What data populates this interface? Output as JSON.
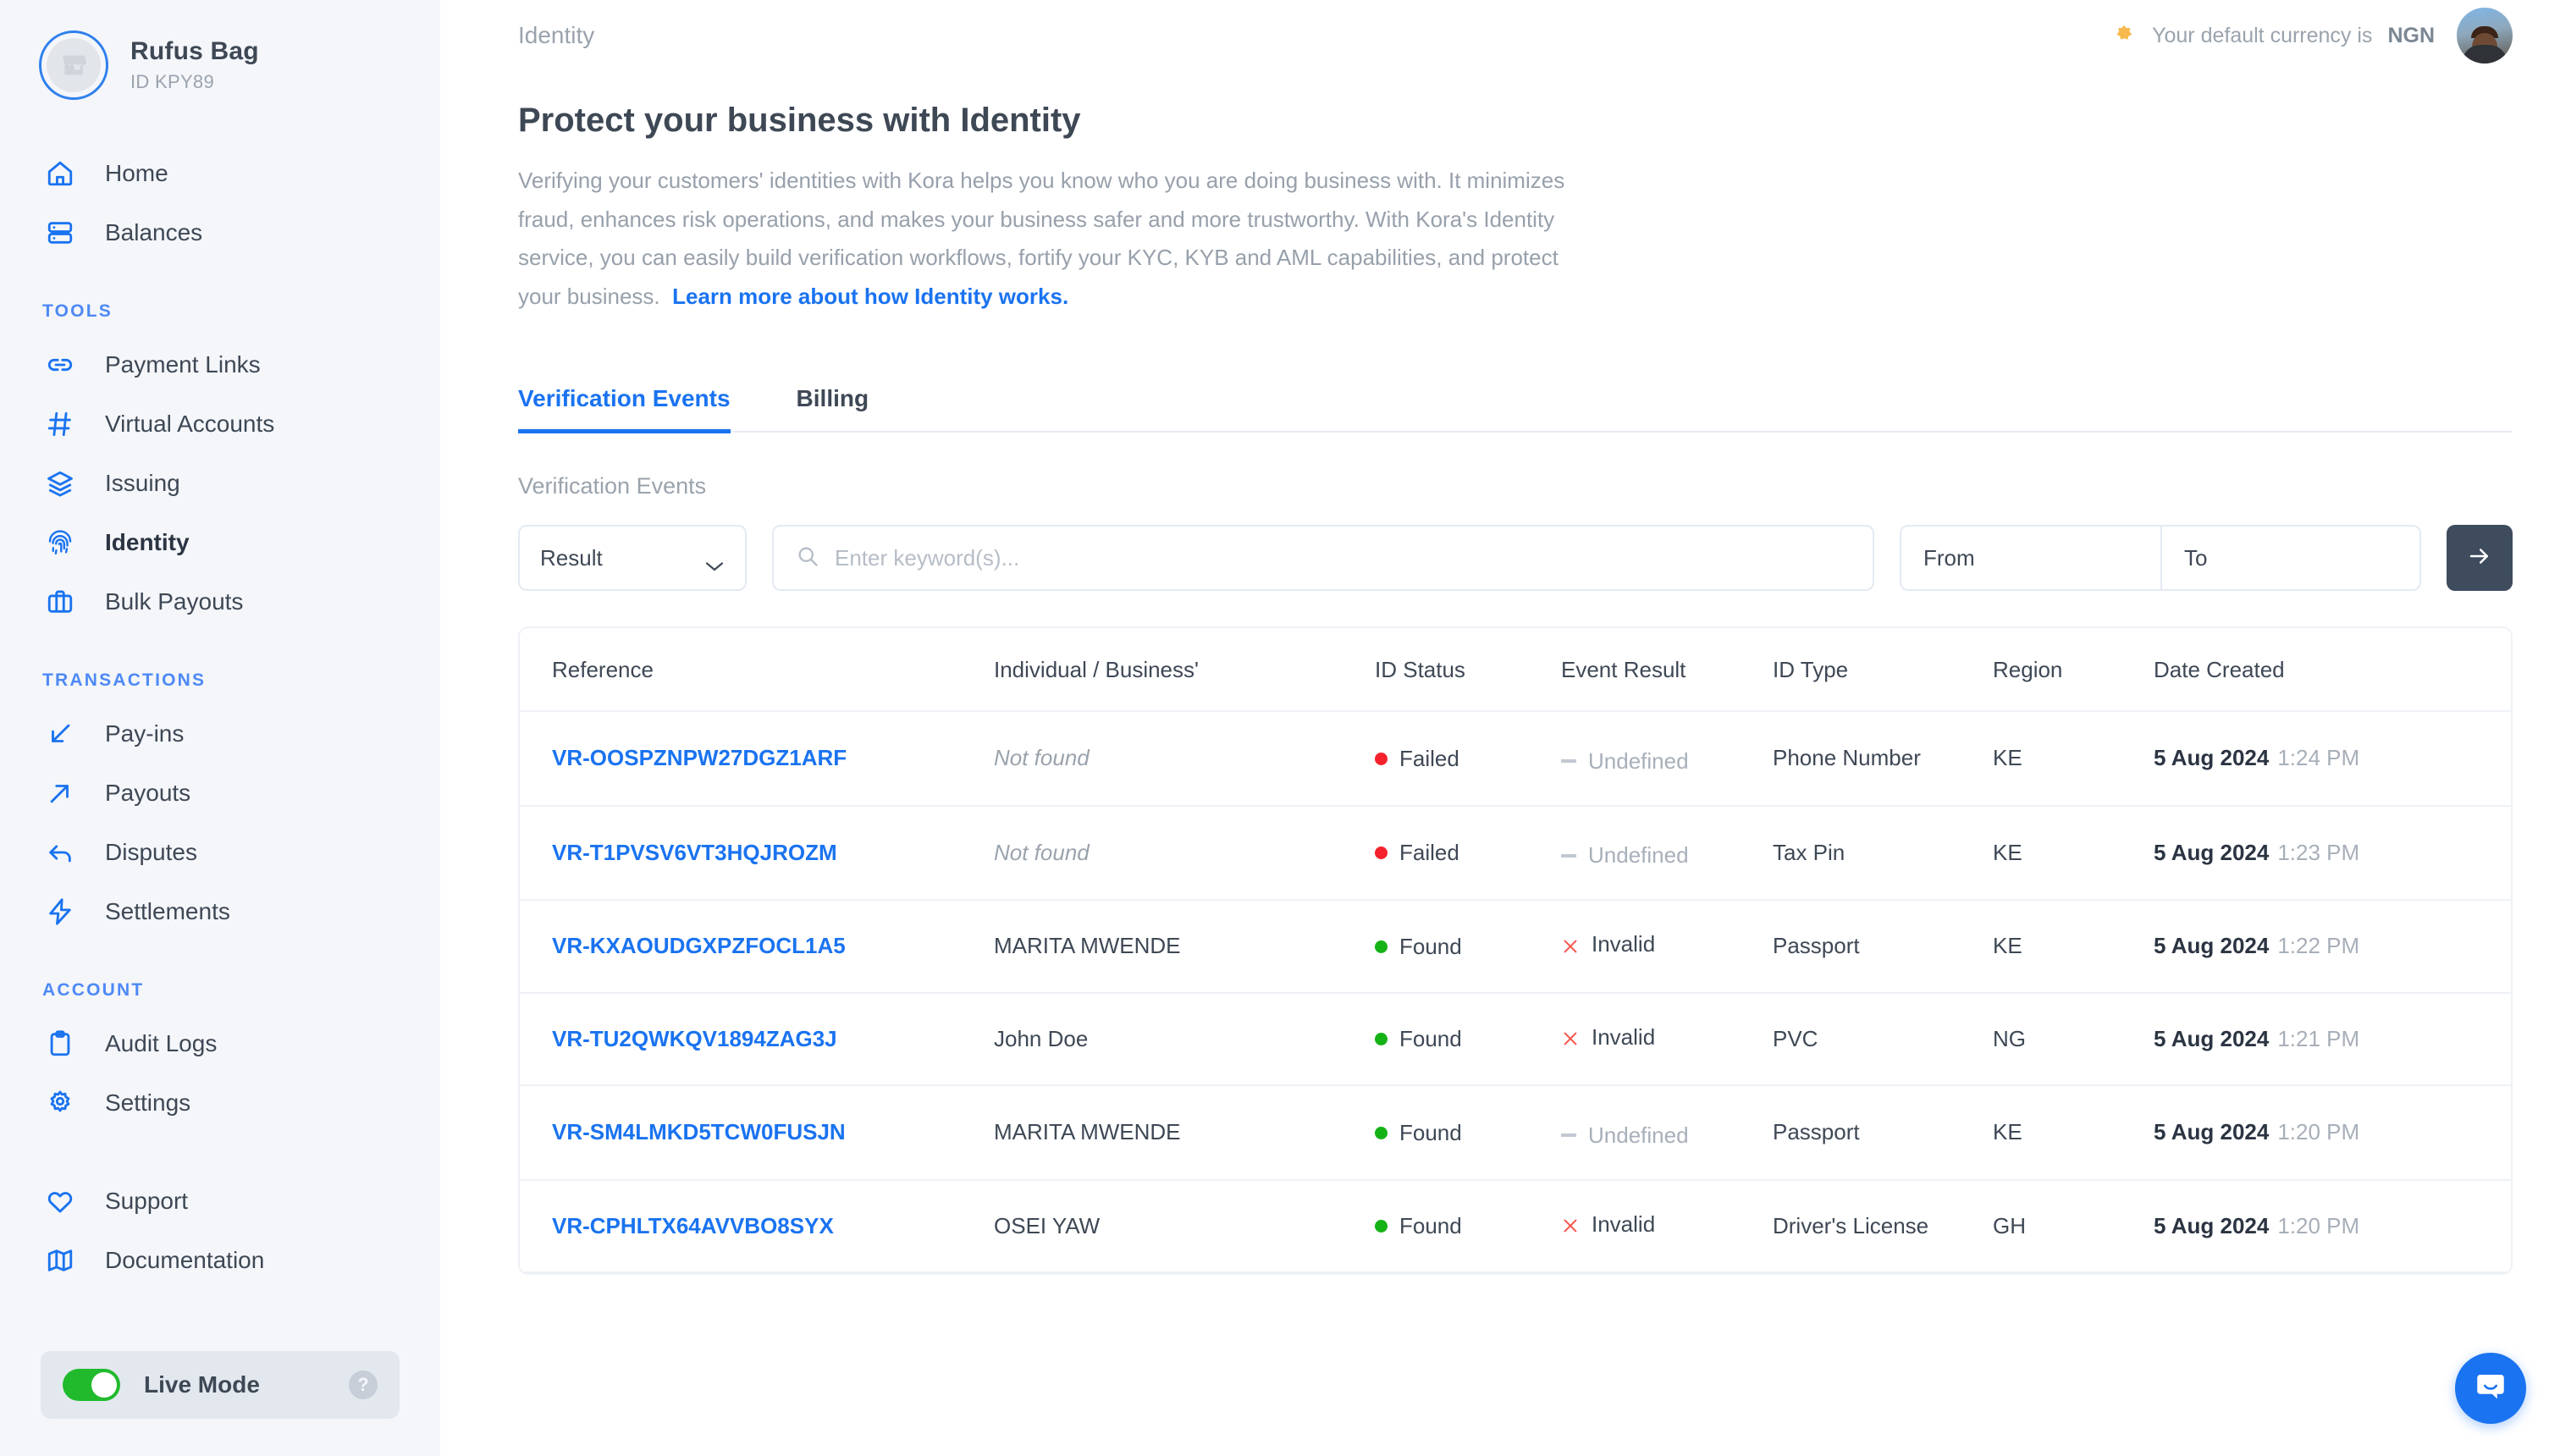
{
  "sidebar": {
    "profile": {
      "name": "Rufus Bag",
      "id": "ID KPY89",
      "avatar_icon": "store-icon"
    },
    "primary_items": [
      {
        "label": "Home",
        "icon": "home-icon"
      },
      {
        "label": "Balances",
        "icon": "balances-icon"
      }
    ],
    "tools_heading": "TOOLS",
    "tools_items": [
      {
        "label": "Payment Links",
        "icon": "link-icon"
      },
      {
        "label": "Virtual Accounts",
        "icon": "hash-icon"
      },
      {
        "label": "Issuing",
        "icon": "layers-icon"
      },
      {
        "label": "Identity",
        "icon": "fingerprint-icon",
        "active": true
      },
      {
        "label": "Bulk Payouts",
        "icon": "briefcase-icon"
      }
    ],
    "transactions_heading": "TRANSACTIONS",
    "transactions_items": [
      {
        "label": "Pay-ins",
        "icon": "arrow-down-left-icon"
      },
      {
        "label": "Payouts",
        "icon": "arrow-up-right-icon"
      },
      {
        "label": "Disputes",
        "icon": "arrow-return-icon"
      },
      {
        "label": "Settlements",
        "icon": "lightning-icon"
      }
    ],
    "account_heading": "ACCOUNT",
    "account_items": [
      {
        "label": "Audit Logs",
        "icon": "clipboard-icon"
      },
      {
        "label": "Settings",
        "icon": "gear-icon"
      }
    ],
    "footer_items": [
      {
        "label": "Support",
        "icon": "heart-icon"
      },
      {
        "label": "Documentation",
        "icon": "map-icon"
      }
    ],
    "live_mode": {
      "label": "Live Mode",
      "enabled": true,
      "help_glyph": "?"
    },
    "accent_color": "#1a73f0",
    "background": "#f4f6fa"
  },
  "topbar": {
    "breadcrumb": "Identity",
    "currency_note_prefix": "Your default currency is",
    "currency": "NGN",
    "star_icon": "star-icon",
    "avatar_name": "user-avatar"
  },
  "page": {
    "title": "Protect your business with Identity",
    "description": "Verifying your customers' identities with Kora helps you know who you are doing business with. It minimizes fraud, enhances risk operations, and makes your business safer and more trustworthy. With Kora's Identity service, you can easily build verification workflows, fortify your KYC, KYB and AML capabilities, and protect your business.",
    "learn_more": "Learn more about how Identity works."
  },
  "tabs": [
    {
      "label": "Verification Events",
      "active": true
    },
    {
      "label": "Billing",
      "active": false
    }
  ],
  "section_label": "Verification Events",
  "filters": {
    "result_select": {
      "value": "Result",
      "chevron_icon": "chevron-down-icon"
    },
    "search": {
      "value": "",
      "placeholder": "Enter keyword(s)...",
      "icon": "search-icon"
    },
    "date_from": {
      "value": "",
      "placeholder": "From"
    },
    "date_to": {
      "value": "",
      "placeholder": "To"
    },
    "submit": {
      "icon": "arrow-right-icon"
    }
  },
  "table": {
    "columns": [
      "Reference",
      "Individual / Business'",
      "ID Status",
      "Event Result",
      "ID Type",
      "Region",
      "Date Created"
    ],
    "rows": [
      {
        "reference": "VR-OOSPZNPW27DGZ1ARF",
        "name": "Not found",
        "name_missing": true,
        "id_status": "Failed",
        "id_status_type": "failed",
        "event_result": "Undefined",
        "event_result_type": "undefined",
        "id_type": "Phone Number",
        "region": "KE",
        "date": "5 Aug 2024",
        "time": "1:24 PM"
      },
      {
        "reference": "VR-T1PVSV6VT3HQJROZM",
        "name": "Not found",
        "name_missing": true,
        "id_status": "Failed",
        "id_status_type": "failed",
        "event_result": "Undefined",
        "event_result_type": "undefined",
        "id_type": "Tax Pin",
        "region": "KE",
        "date": "5 Aug 2024",
        "time": "1:23 PM"
      },
      {
        "reference": "VR-KXAOUDGXPZFOCL1A5",
        "name": "MARITA MWENDE",
        "name_missing": false,
        "id_status": "Found",
        "id_status_type": "found",
        "event_result": "Invalid",
        "event_result_type": "invalid",
        "id_type": "Passport",
        "region": "KE",
        "date": "5 Aug 2024",
        "time": "1:22 PM"
      },
      {
        "reference": "VR-TU2QWKQV1894ZAG3J",
        "name": "John Doe",
        "name_missing": false,
        "id_status": "Found",
        "id_status_type": "found",
        "event_result": "Invalid",
        "event_result_type": "invalid",
        "id_type": "PVC",
        "region": "NG",
        "date": "5 Aug 2024",
        "time": "1:21 PM"
      },
      {
        "reference": "VR-SM4LMKD5TCW0FUSJN",
        "name": "MARITA MWENDE",
        "name_missing": false,
        "id_status": "Found",
        "id_status_type": "found",
        "event_result": "Undefined",
        "event_result_type": "undefined",
        "id_type": "Passport",
        "region": "KE",
        "date": "5 Aug 2024",
        "time": "1:20 PM"
      },
      {
        "reference": "VR-CPHLTX64AVVBO8SYX",
        "name": "OSEI YAW",
        "name_missing": false,
        "id_status": "Found",
        "id_status_type": "found",
        "event_result": "Invalid",
        "event_result_type": "invalid",
        "id_type": "Driver's License",
        "region": "GH",
        "date": "5 Aug 2024",
        "time": "1:20 PM"
      }
    ]
  },
  "chat_widget": {
    "icon": "chat-bubble-icon",
    "color": "#1a73f0"
  },
  "colors": {
    "accent": "#1a73f0",
    "failed": "#f5222d",
    "found": "#15b215",
    "invalid": "#f5554a",
    "undefined": "#c2c9d2",
    "toggle_on": "#21ba2c",
    "dark_button": "#3e4c5e",
    "star": "#f7b94e"
  }
}
